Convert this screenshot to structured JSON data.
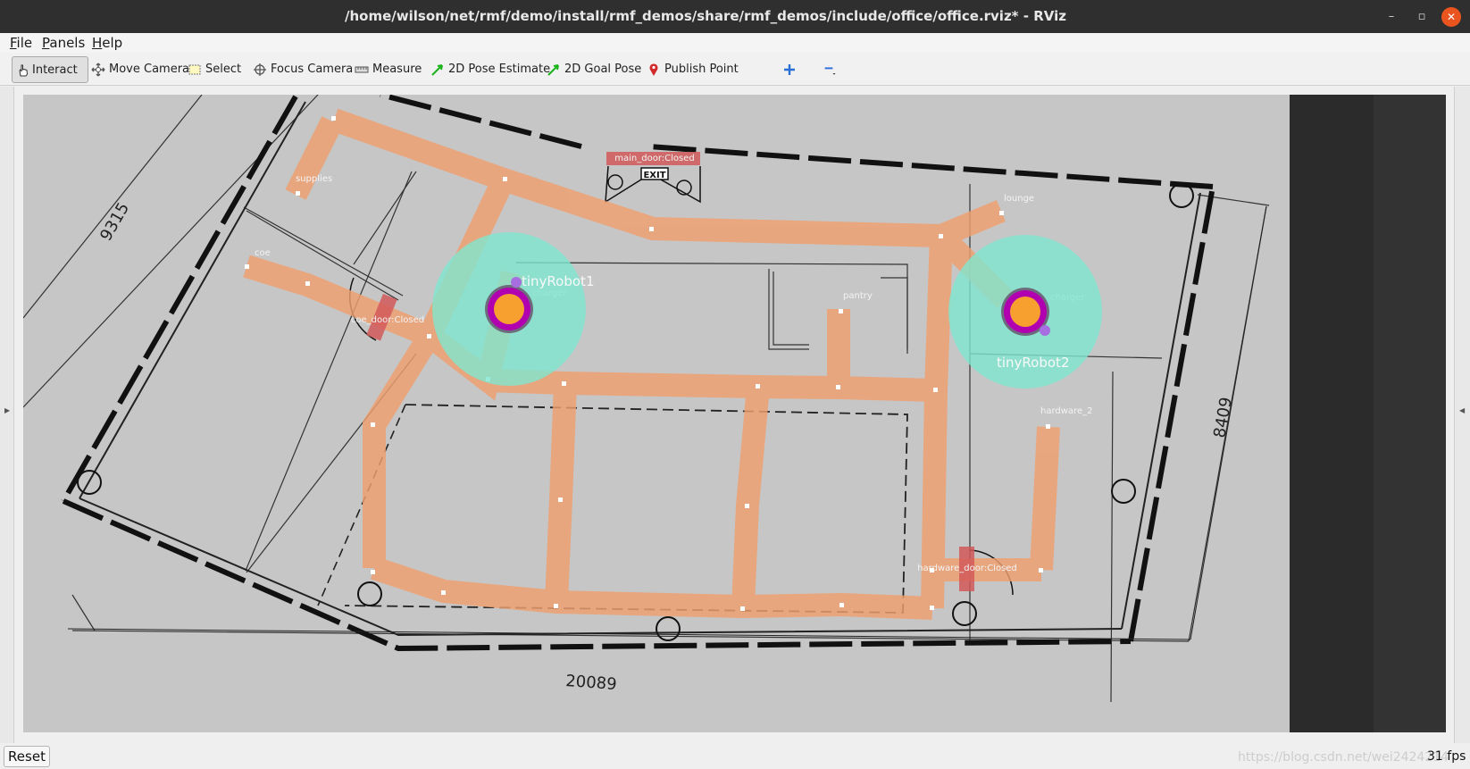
{
  "window": {
    "title": "/home/wilson/net/rmf/demo/install/rmf_demos/share/rmf_demos/include/office/office.rviz* - RViz",
    "minimize_glyph": "–",
    "maximize_glyph": "▫",
    "close_glyph": "✕"
  },
  "menubar": {
    "file": {
      "key": "F",
      "rest": "ile"
    },
    "panels": {
      "key": "P",
      "rest": "anels"
    },
    "help": {
      "key": "H",
      "rest": "elp"
    }
  },
  "toolbar": {
    "interact": "Interact",
    "move_camera": "Move Camera",
    "select": "Select",
    "focus_camera": "Focus Camera",
    "measure": "Measure",
    "pose_estimate": "2D Pose Estimate",
    "goal_pose": "2D Goal Pose",
    "publish_point": "Publish Point",
    "icons": {
      "interact": "hand-pointer-icon",
      "move_camera": "move-arrows-icon",
      "select": "selection-rectangle-icon",
      "focus_camera": "crosshair-icon",
      "measure": "ruler-icon",
      "pose_estimate": "green-arrow-icon",
      "goal_pose": "green-arrow-icon",
      "publish_point": "map-pin-icon",
      "add": "plus-icon",
      "remove": "minus-icon"
    }
  },
  "viewport": {
    "dimensions": {
      "top": "9315",
      "bottom": "20089",
      "right": "8409"
    },
    "waypoints": [
      "supplies",
      "coe",
      "pantry",
      "lounge",
      "hardware_2",
      "charger",
      "charger"
    ],
    "doors": [
      "main_door:Closed",
      "coe_door:Closed",
      "hardware_door:Closed"
    ],
    "exit_sign": "EXIT",
    "robots": [
      "tinyRobot1",
      "tinyRobot2"
    ],
    "colors": {
      "lane": "#f0a070",
      "door": "#d25a5a",
      "footprint": "#7fe6cf",
      "robot_ring": "#b000b0",
      "robot_body": "#f7a030",
      "floor": "#c6c6c6"
    }
  },
  "statusbar": {
    "reset": "Reset",
    "fps": "31 fps",
    "watermark": "https://blog.csdn.net/wei2424214"
  }
}
